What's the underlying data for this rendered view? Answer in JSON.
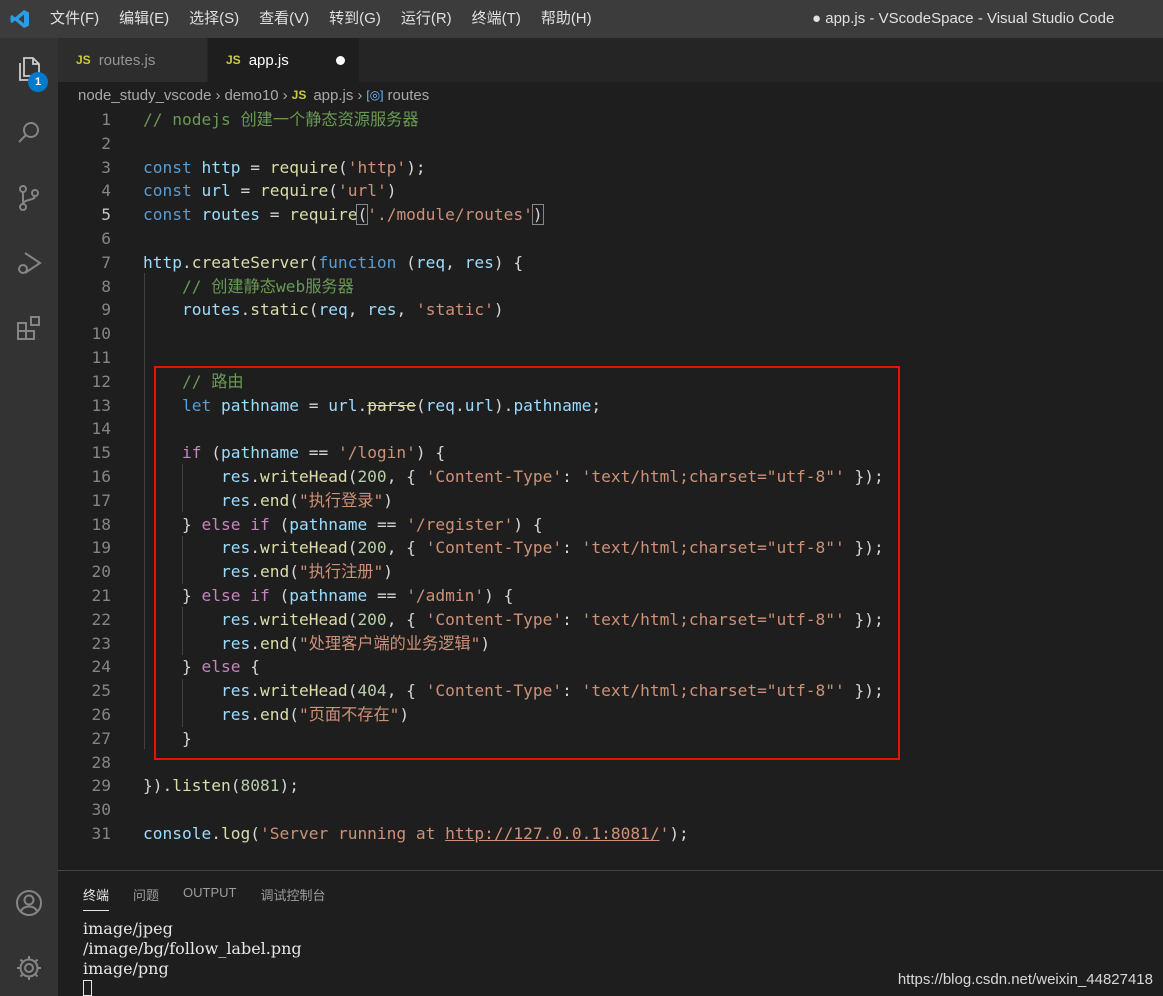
{
  "titlebar": {
    "menu": [
      "文件(F)",
      "编辑(E)",
      "选择(S)",
      "查看(V)",
      "转到(G)",
      "运行(R)",
      "终端(T)",
      "帮助(H)"
    ],
    "window_title": "● app.js - VScodeSpace - Visual Studio Code"
  },
  "activitybar": {
    "explorer_badge": "1"
  },
  "tabs": [
    {
      "icon": "JS",
      "label": "routes.js"
    },
    {
      "icon": "JS",
      "label": "app.js"
    }
  ],
  "breadcrumb": {
    "folder": "node_study_vscode",
    "subfolder": "demo10",
    "file_icon": "JS",
    "file": "app.js",
    "symbol": "routes"
  },
  "editor": {
    "line_numbers": [
      "1",
      "2",
      "3",
      "4",
      "5",
      "6",
      "7",
      "8",
      "9",
      "10",
      "11",
      "12",
      "13",
      "14",
      "15",
      "16",
      "17",
      "18",
      "19",
      "20",
      "21",
      "22",
      "23",
      "24",
      "25",
      "26",
      "27",
      "28",
      "29",
      "30",
      "31"
    ]
  },
  "panel": {
    "tabs": [
      "终端",
      "问题",
      "OUTPUT",
      "调试控制台"
    ],
    "terminal_lines": [
      "image/jpeg",
      "/image/bg/follow_label.png",
      "image/png"
    ]
  },
  "watermark": "https://blog.csdn.net/weixin_44827418",
  "colors": {
    "accent": "#007acc",
    "highlight_box": "#e51400",
    "keyword": "#569cd6",
    "string": "#ce9178",
    "comment": "#6a9955"
  }
}
